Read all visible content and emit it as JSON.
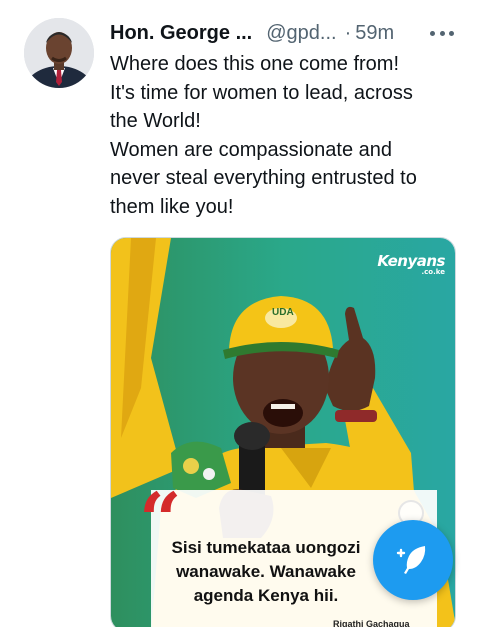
{
  "tweet": {
    "author": {
      "display_name": "Hon. George ...",
      "handle": "@gpd...",
      "separator": "·",
      "time": "59m"
    },
    "text_lines": [
      "Where does this one come from!",
      "It's time for women to lead, across",
      "the World!",
      "Women are compassionate and",
      "never steal everything entrusted to",
      "them like you!"
    ],
    "more_icon": "more-horizontal-icon"
  },
  "media": {
    "watermark": "Kenyans",
    "watermark_sub": ".co.ke",
    "cap_text": "UDA",
    "quote_mark": "“",
    "quote_lines": [
      "Sisi tumekataa uongozi",
      "wanawake. Wanawake",
      "agenda Kenya hii."
    ],
    "attribution": "Rigathi Gachagua"
  },
  "fab": {
    "icon": "compose-tweet-icon",
    "color": "#1d9bf0"
  },
  "colors": {
    "text": "#0f1419",
    "secondary": "#536471",
    "accent": "#1d9bf0",
    "quote_red": "#d42a2a"
  }
}
